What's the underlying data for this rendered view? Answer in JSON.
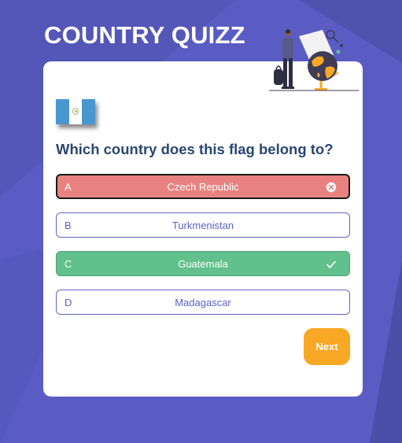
{
  "app": {
    "title": "COUNTRY QUIZZ",
    "colors": {
      "background": "#5a5cc4",
      "accent": "#f9a826",
      "wrong": "#e88281",
      "correct": "#61c08b",
      "text_heading": "#2a4771",
      "option_text": "#5c62c2"
    }
  },
  "quiz": {
    "flag_icon": "guatemala-flag",
    "question": "Which country does this flag belong to?",
    "options": [
      {
        "letter": "A",
        "label": "Czech Republic",
        "state": "wrong",
        "icon": "x-circle-icon"
      },
      {
        "letter": "B",
        "label": "Turkmenistan",
        "state": "default"
      },
      {
        "letter": "C",
        "label": "Guatemala",
        "state": "correct",
        "icon": "check-icon"
      },
      {
        "letter": "D",
        "label": "Madagascar",
        "state": "default"
      }
    ],
    "next_label": "Next"
  }
}
